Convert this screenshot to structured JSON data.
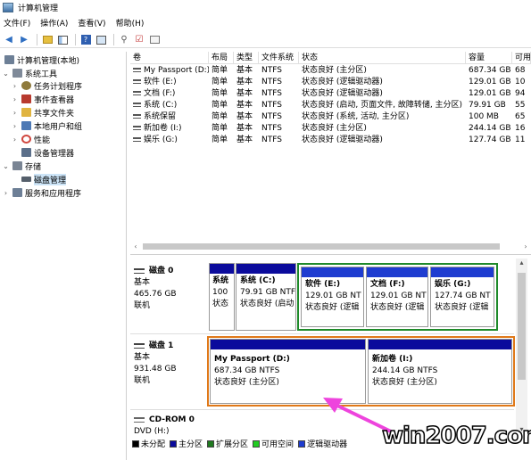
{
  "window": {
    "title": "计算机管理"
  },
  "menu": [
    "文件(F)",
    "操作(A)",
    "查看(V)",
    "帮助(H)"
  ],
  "tree": {
    "items": [
      {
        "label": "计算机管理(本地)",
        "level": 0,
        "expander": "",
        "icon": "computer-icon",
        "color": "#6d7f96"
      },
      {
        "label": "系统工具",
        "level": 1,
        "expander": "⌄",
        "icon": "tools-icon",
        "color": "#7f8a99"
      },
      {
        "label": "任务计划程序",
        "level": 2,
        "expander": "›",
        "icon": "clock-icon",
        "color": "#8f7a3c"
      },
      {
        "label": "事件查看器",
        "level": 2,
        "expander": "›",
        "icon": "event-viewer-icon",
        "color": "#b83a2f"
      },
      {
        "label": "共享文件夹",
        "level": 2,
        "expander": "›",
        "icon": "shared-folder-icon",
        "color": "#e0b440"
      },
      {
        "label": "本地用户和组",
        "level": 2,
        "expander": "›",
        "icon": "users-icon",
        "color": "#4d79b5"
      },
      {
        "label": "性能",
        "level": 2,
        "expander": "›",
        "icon": "performance-icon",
        "color": "#d0473f"
      },
      {
        "label": "设备管理器",
        "level": 2,
        "expander": "",
        "icon": "device-manager-icon",
        "color": "#5b6f8a"
      },
      {
        "label": "存储",
        "level": 1,
        "expander": "⌄",
        "icon": "storage-icon",
        "color": "#7a8594"
      },
      {
        "label": "磁盘管理",
        "level": 2,
        "expander": "",
        "icon": "disk-management-icon",
        "color": "#555f6b",
        "selected": true
      },
      {
        "label": "服务和应用程序",
        "level": 1,
        "expander": "›",
        "icon": "services-icon",
        "color": "#6d7f96"
      }
    ]
  },
  "volume_list": {
    "columns": [
      "卷",
      "布局",
      "类型",
      "文件系统",
      "状态",
      "容量",
      "可用"
    ],
    "rows": [
      [
        "My Passport (D:)",
        "简单",
        "基本",
        "NTFS",
        "状态良好 (主分区)",
        "687.34 GB",
        "68"
      ],
      [
        "软件 (E:)",
        "简单",
        "基本",
        "NTFS",
        "状态良好 (逻辑驱动器)",
        "129.01 GB",
        "10"
      ],
      [
        "文档 (F:)",
        "简单",
        "基本",
        "NTFS",
        "状态良好 (逻辑驱动器)",
        "129.01 GB",
        "94"
      ],
      [
        "系统 (C:)",
        "简单",
        "基本",
        "NTFS",
        "状态良好 (启动, 页面文件, 故障转储, 主分区)",
        "79.91 GB",
        "55"
      ],
      [
        "系统保留",
        "简单",
        "基本",
        "NTFS",
        "状态良好 (系统, 活动, 主分区)",
        "100 MB",
        "65"
      ],
      [
        "新加卷 (I:)",
        "简单",
        "基本",
        "NTFS",
        "状态良好 (主分区)",
        "244.14 GB",
        "16"
      ],
      [
        "娱乐 (G:)",
        "简单",
        "基本",
        "NTFS",
        "状态良好 (逻辑驱动器)",
        "127.74 GB",
        "11"
      ]
    ]
  },
  "disks": [
    {
      "name": "磁盘 0",
      "type": "基本",
      "size": "465.76 GB",
      "status": "联机",
      "partitions": [
        {
          "name": "系统",
          "line2": "100",
          "line3": "状态"
        },
        {
          "name": "系统 (C:)",
          "line2": "79.91 GB NTF",
          "line3": "状态良好 (启动"
        },
        {
          "name": "软件 (E:)",
          "line2": "129.01 GB NT",
          "line3": "状态良好 (逻辑"
        },
        {
          "name": "文档 (F:)",
          "line2": "129.01 GB NT",
          "line3": "状态良好 (逻辑"
        },
        {
          "name": "娱乐 (G:)",
          "line2": "127.74 GB NT",
          "line3": "状态良好 (逻辑"
        }
      ]
    },
    {
      "name": "磁盘 1",
      "type": "基本",
      "size": "931.48 GB",
      "status": "联机",
      "partitions": [
        {
          "name": "My Passport (D:)",
          "line2": "687.34 GB NTFS",
          "line3": "状态良好 (主分区)"
        },
        {
          "name": "新加卷 (I:)",
          "line2": "244.14 GB NTFS",
          "line3": "状态良好 (主分区)"
        }
      ]
    },
    {
      "name": "CD-ROM 0",
      "type": "DVD (H:)"
    }
  ],
  "legend": [
    {
      "label": "未分配",
      "color": "#000000"
    },
    {
      "label": "主分区",
      "color": "#0b0b9c"
    },
    {
      "label": "扩展分区",
      "color": "#1f7a1f"
    },
    {
      "label": "可用空间",
      "color": "#22cc22"
    },
    {
      "label": "逻辑驱动器",
      "color": "#1e3cd0"
    }
  ],
  "highlight_colors": {
    "extended_partition_border": "#1f8a2a",
    "disk1_highlight": "#e07818",
    "arrow": "#ee44dd"
  },
  "watermark": "win2007.com"
}
